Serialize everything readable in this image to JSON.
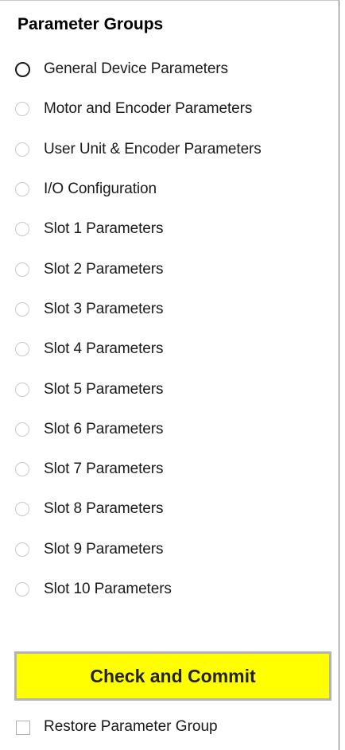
{
  "panel": {
    "title": "Parameter Groups",
    "selected_index": 0,
    "options": [
      {
        "label": "General Device Parameters"
      },
      {
        "label": "Motor and Encoder Parameters"
      },
      {
        "label": "User Unit & Encoder Parameters"
      },
      {
        "label": "I/O Configuration"
      },
      {
        "label": "Slot 1 Parameters"
      },
      {
        "label": "Slot 2 Parameters"
      },
      {
        "label": "Slot 3 Parameters"
      },
      {
        "label": "Slot 4 Parameters"
      },
      {
        "label": "Slot 5 Parameters"
      },
      {
        "label": "Slot 6 Parameters"
      },
      {
        "label": "Slot 7 Parameters"
      },
      {
        "label": "Slot 8 Parameters"
      },
      {
        "label": "Slot 9 Parameters"
      },
      {
        "label": "Slot 10 Parameters"
      }
    ],
    "commit_button": {
      "label": "Check and Commit",
      "color": "#ffff00"
    },
    "restore_checkbox": {
      "label": "Restore Parameter Group",
      "checked": false
    }
  }
}
